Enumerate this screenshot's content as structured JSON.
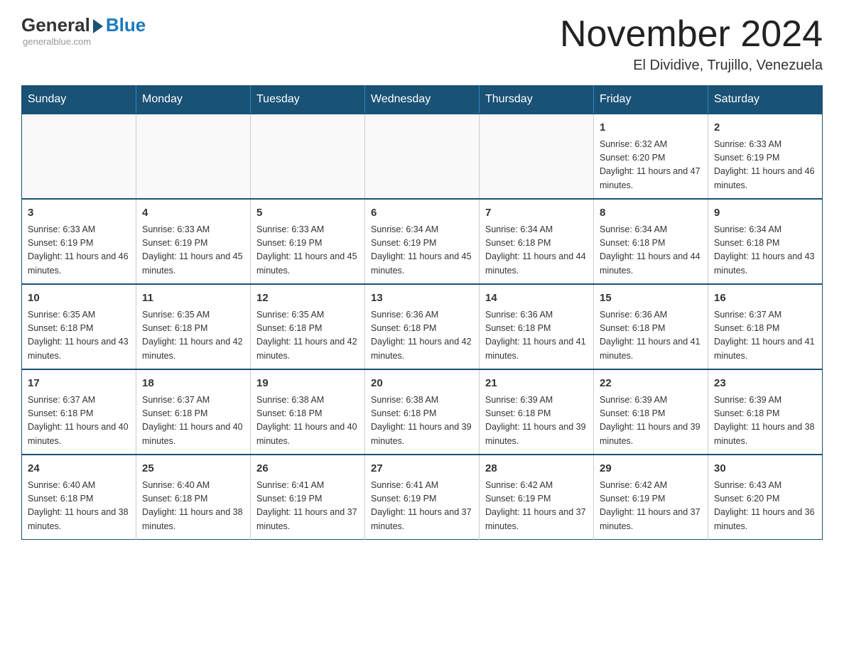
{
  "header": {
    "logo": {
      "general": "General",
      "blue": "Blue",
      "tagline": "generalblue.com"
    },
    "title": "November 2024",
    "location": "El Dividive, Trujillo, Venezuela"
  },
  "calendar": {
    "days_of_week": [
      "Sunday",
      "Monday",
      "Tuesday",
      "Wednesday",
      "Thursday",
      "Friday",
      "Saturday"
    ],
    "weeks": [
      {
        "days": [
          {
            "num": "",
            "info": ""
          },
          {
            "num": "",
            "info": ""
          },
          {
            "num": "",
            "info": ""
          },
          {
            "num": "",
            "info": ""
          },
          {
            "num": "",
            "info": ""
          },
          {
            "num": "1",
            "info": "Sunrise: 6:32 AM\nSunset: 6:20 PM\nDaylight: 11 hours and 47 minutes."
          },
          {
            "num": "2",
            "info": "Sunrise: 6:33 AM\nSunset: 6:19 PM\nDaylight: 11 hours and 46 minutes."
          }
        ]
      },
      {
        "days": [
          {
            "num": "3",
            "info": "Sunrise: 6:33 AM\nSunset: 6:19 PM\nDaylight: 11 hours and 46 minutes."
          },
          {
            "num": "4",
            "info": "Sunrise: 6:33 AM\nSunset: 6:19 PM\nDaylight: 11 hours and 45 minutes."
          },
          {
            "num": "5",
            "info": "Sunrise: 6:33 AM\nSunset: 6:19 PM\nDaylight: 11 hours and 45 minutes."
          },
          {
            "num": "6",
            "info": "Sunrise: 6:34 AM\nSunset: 6:19 PM\nDaylight: 11 hours and 45 minutes."
          },
          {
            "num": "7",
            "info": "Sunrise: 6:34 AM\nSunset: 6:18 PM\nDaylight: 11 hours and 44 minutes."
          },
          {
            "num": "8",
            "info": "Sunrise: 6:34 AM\nSunset: 6:18 PM\nDaylight: 11 hours and 44 minutes."
          },
          {
            "num": "9",
            "info": "Sunrise: 6:34 AM\nSunset: 6:18 PM\nDaylight: 11 hours and 43 minutes."
          }
        ]
      },
      {
        "days": [
          {
            "num": "10",
            "info": "Sunrise: 6:35 AM\nSunset: 6:18 PM\nDaylight: 11 hours and 43 minutes."
          },
          {
            "num": "11",
            "info": "Sunrise: 6:35 AM\nSunset: 6:18 PM\nDaylight: 11 hours and 42 minutes."
          },
          {
            "num": "12",
            "info": "Sunrise: 6:35 AM\nSunset: 6:18 PM\nDaylight: 11 hours and 42 minutes."
          },
          {
            "num": "13",
            "info": "Sunrise: 6:36 AM\nSunset: 6:18 PM\nDaylight: 11 hours and 42 minutes."
          },
          {
            "num": "14",
            "info": "Sunrise: 6:36 AM\nSunset: 6:18 PM\nDaylight: 11 hours and 41 minutes."
          },
          {
            "num": "15",
            "info": "Sunrise: 6:36 AM\nSunset: 6:18 PM\nDaylight: 11 hours and 41 minutes."
          },
          {
            "num": "16",
            "info": "Sunrise: 6:37 AM\nSunset: 6:18 PM\nDaylight: 11 hours and 41 minutes."
          }
        ]
      },
      {
        "days": [
          {
            "num": "17",
            "info": "Sunrise: 6:37 AM\nSunset: 6:18 PM\nDaylight: 11 hours and 40 minutes."
          },
          {
            "num": "18",
            "info": "Sunrise: 6:37 AM\nSunset: 6:18 PM\nDaylight: 11 hours and 40 minutes."
          },
          {
            "num": "19",
            "info": "Sunrise: 6:38 AM\nSunset: 6:18 PM\nDaylight: 11 hours and 40 minutes."
          },
          {
            "num": "20",
            "info": "Sunrise: 6:38 AM\nSunset: 6:18 PM\nDaylight: 11 hours and 39 minutes."
          },
          {
            "num": "21",
            "info": "Sunrise: 6:39 AM\nSunset: 6:18 PM\nDaylight: 11 hours and 39 minutes."
          },
          {
            "num": "22",
            "info": "Sunrise: 6:39 AM\nSunset: 6:18 PM\nDaylight: 11 hours and 39 minutes."
          },
          {
            "num": "23",
            "info": "Sunrise: 6:39 AM\nSunset: 6:18 PM\nDaylight: 11 hours and 38 minutes."
          }
        ]
      },
      {
        "days": [
          {
            "num": "24",
            "info": "Sunrise: 6:40 AM\nSunset: 6:18 PM\nDaylight: 11 hours and 38 minutes."
          },
          {
            "num": "25",
            "info": "Sunrise: 6:40 AM\nSunset: 6:18 PM\nDaylight: 11 hours and 38 minutes."
          },
          {
            "num": "26",
            "info": "Sunrise: 6:41 AM\nSunset: 6:19 PM\nDaylight: 11 hours and 37 minutes."
          },
          {
            "num": "27",
            "info": "Sunrise: 6:41 AM\nSunset: 6:19 PM\nDaylight: 11 hours and 37 minutes."
          },
          {
            "num": "28",
            "info": "Sunrise: 6:42 AM\nSunset: 6:19 PM\nDaylight: 11 hours and 37 minutes."
          },
          {
            "num": "29",
            "info": "Sunrise: 6:42 AM\nSunset: 6:19 PM\nDaylight: 11 hours and 37 minutes."
          },
          {
            "num": "30",
            "info": "Sunrise: 6:43 AM\nSunset: 6:20 PM\nDaylight: 11 hours and 36 minutes."
          }
        ]
      }
    ]
  }
}
